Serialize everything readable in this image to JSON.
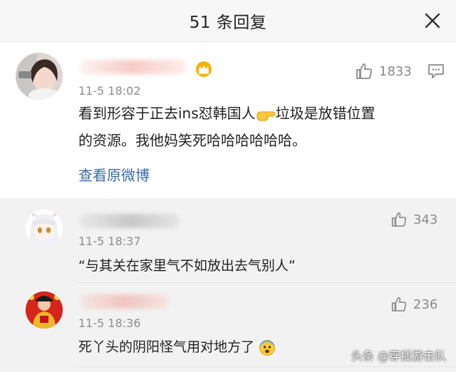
{
  "header": {
    "title": "51 条回复",
    "close_icon": "close-icon"
  },
  "main_comment": {
    "time": "11-5 18:02",
    "likes": "1833",
    "text_line1_a": "看到形容于正去ins怼韩国人",
    "text_line1_b": "垃圾是放错位置",
    "text_line2": "的资源。我他妈笑死哈哈哈哈哈哈。",
    "view_original": "查看原微博",
    "badge_icon": "crown-badge-icon",
    "reply_icon": "comment-icon"
  },
  "replies": [
    {
      "time": "11-5 18:37",
      "likes": "343",
      "text": "“与其关在家里气不如放出去气别人”"
    },
    {
      "time": "11-5 18:36",
      "likes": "236",
      "text": "死丫头的阴阳怪气用对地方了"
    }
  ],
  "watermark": "头条 @穿插游击队",
  "colors": {
    "link": "#3b6aa6",
    "reply_bg": "#f2f2f2",
    "header_bg": "#f7f7f7"
  }
}
